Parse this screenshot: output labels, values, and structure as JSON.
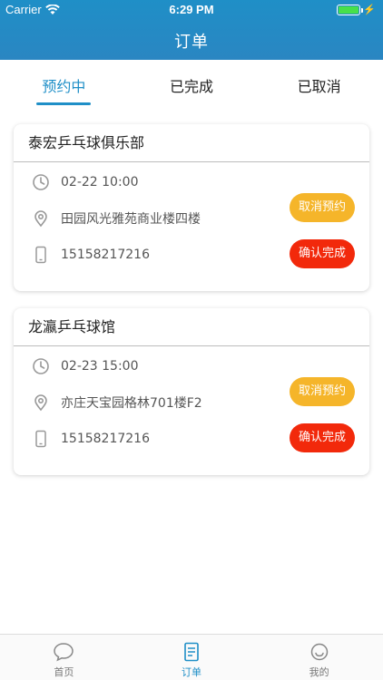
{
  "status_bar": {
    "carrier": "Carrier",
    "time": "6:29 PM"
  },
  "nav": {
    "title": "订单"
  },
  "tabs": [
    {
      "label": "预约中",
      "active": true
    },
    {
      "label": "已完成",
      "active": false
    },
    {
      "label": "已取消",
      "active": false
    }
  ],
  "orders": [
    {
      "venue": "泰宏乒乓球俱乐部",
      "time": "02-22 10:00",
      "address": "田园风光雅苑商业楼四楼",
      "phone": "15158217216",
      "cancel_label": "取消预约",
      "confirm_label": "确认完成"
    },
    {
      "venue": "龙瀛乒乓球馆",
      "time": "02-23 15:00",
      "address": "亦庄天宝园格林701楼F2",
      "phone": "15158217216",
      "cancel_label": "取消预约",
      "confirm_label": "确认完成"
    }
  ],
  "tabbar": [
    {
      "label": "首页",
      "icon": "chat-bubble-icon",
      "active": false
    },
    {
      "label": "订单",
      "icon": "document-icon",
      "active": true
    },
    {
      "label": "我的",
      "icon": "profile-icon",
      "active": false
    }
  ],
  "colors": {
    "primary": "#1f8fc7",
    "cancel": "#f5b52a",
    "confirm": "#f2290b"
  }
}
